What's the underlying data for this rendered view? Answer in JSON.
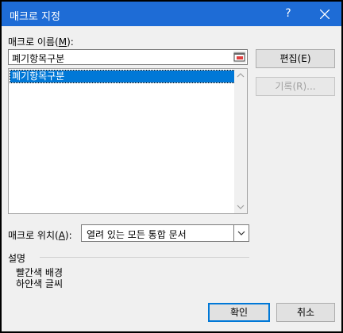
{
  "window": {
    "title": "매크로 지정",
    "help_label": "?"
  },
  "macro_name": {
    "label": "매크로 이름(",
    "label_key": "M",
    "label_end": "):",
    "value": "폐기항목구분"
  },
  "macro_list": {
    "items": [
      "폐기항목구분"
    ]
  },
  "buttons": {
    "edit": "편집(E)",
    "record": "기록(R)...",
    "ok": "확인",
    "cancel": "취소"
  },
  "macro_location": {
    "label": "매크로 위치(",
    "label_key": "A",
    "label_end": "):",
    "selected": "열려 있는 모든 통합 문서"
  },
  "description": {
    "heading": "설명",
    "line1": "빨간색 배경",
    "line2": "하얀색 글씨"
  }
}
